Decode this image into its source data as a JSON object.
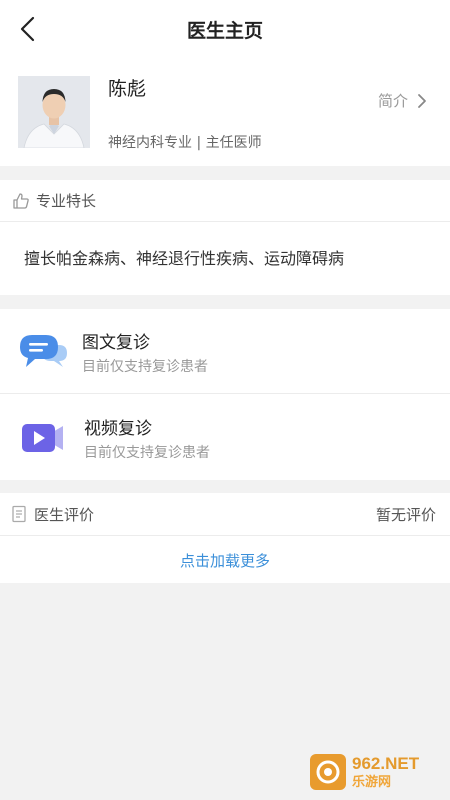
{
  "header": {
    "title": "医生主页"
  },
  "doctor": {
    "name": "陈彪",
    "department_title": "神经内科专业 | 主任医师",
    "intro_label": "简介"
  },
  "specialty": {
    "label": "专业特长",
    "text": "擅长帕金森病、神经退行性疾病、运动障碍病"
  },
  "services": [
    {
      "name": "图文复诊",
      "desc": "目前仅支持复诊患者",
      "icon": "chat-bubble-icon"
    },
    {
      "name": "视频复诊",
      "desc": "目前仅支持复诊患者",
      "icon": "video-camera-icon"
    }
  ],
  "reviews": {
    "label": "医生评价",
    "status": "暂无评价",
    "load_more": "点击加载更多"
  },
  "watermark": {
    "brand": "962.NET",
    "sub": "乐游网"
  },
  "colors": {
    "accent": "#3b8fd9",
    "icon_blue": "#4a8de8",
    "icon_purple": "#6c63e6",
    "background": "#f2f2f2"
  }
}
